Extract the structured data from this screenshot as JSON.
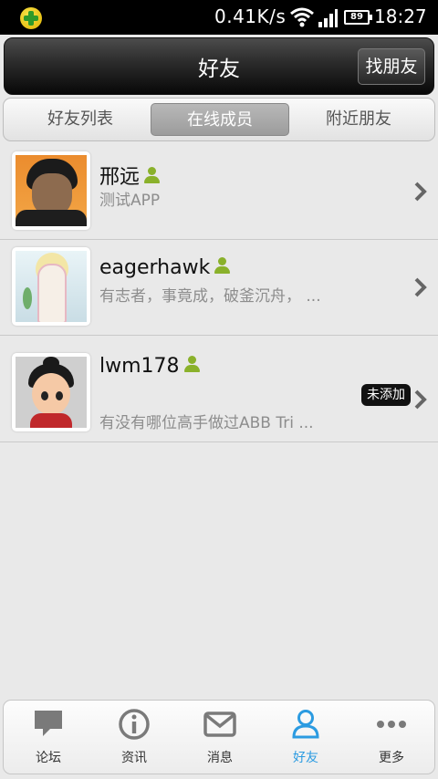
{
  "status_bar": {
    "network_speed": "0.41K/s",
    "battery": "89",
    "time": "18:27"
  },
  "header": {
    "title": "好友",
    "find_friends_label": "找朋友"
  },
  "tabs": [
    {
      "label": "好友列表"
    },
    {
      "label": "在线成员",
      "selected": true
    },
    {
      "label": "附近朋友"
    }
  ],
  "friends": [
    {
      "name": "邢远",
      "description": "测试APP",
      "status_icon": "person-icon"
    },
    {
      "name": "eagerhawk",
      "description": "有志者，事竟成，破釜沉舟， ...",
      "status_icon": "person-icon"
    },
    {
      "name": "lwm178",
      "description": "有没有哪位高手做过ABB Tri ...",
      "status_icon": "person-icon",
      "badge": "未添加"
    }
  ],
  "bottom_nav": [
    {
      "label": "论坛",
      "icon": "speech-bubble-icon"
    },
    {
      "label": "资讯",
      "icon": "info-icon"
    },
    {
      "label": "消息",
      "icon": "envelope-icon"
    },
    {
      "label": "好友",
      "icon": "person-icon",
      "active": true
    },
    {
      "label": "更多",
      "icon": "more-dots-icon"
    }
  ],
  "colors": {
    "accent": "#2b9be1",
    "online_icon": "#8ab12b"
  }
}
